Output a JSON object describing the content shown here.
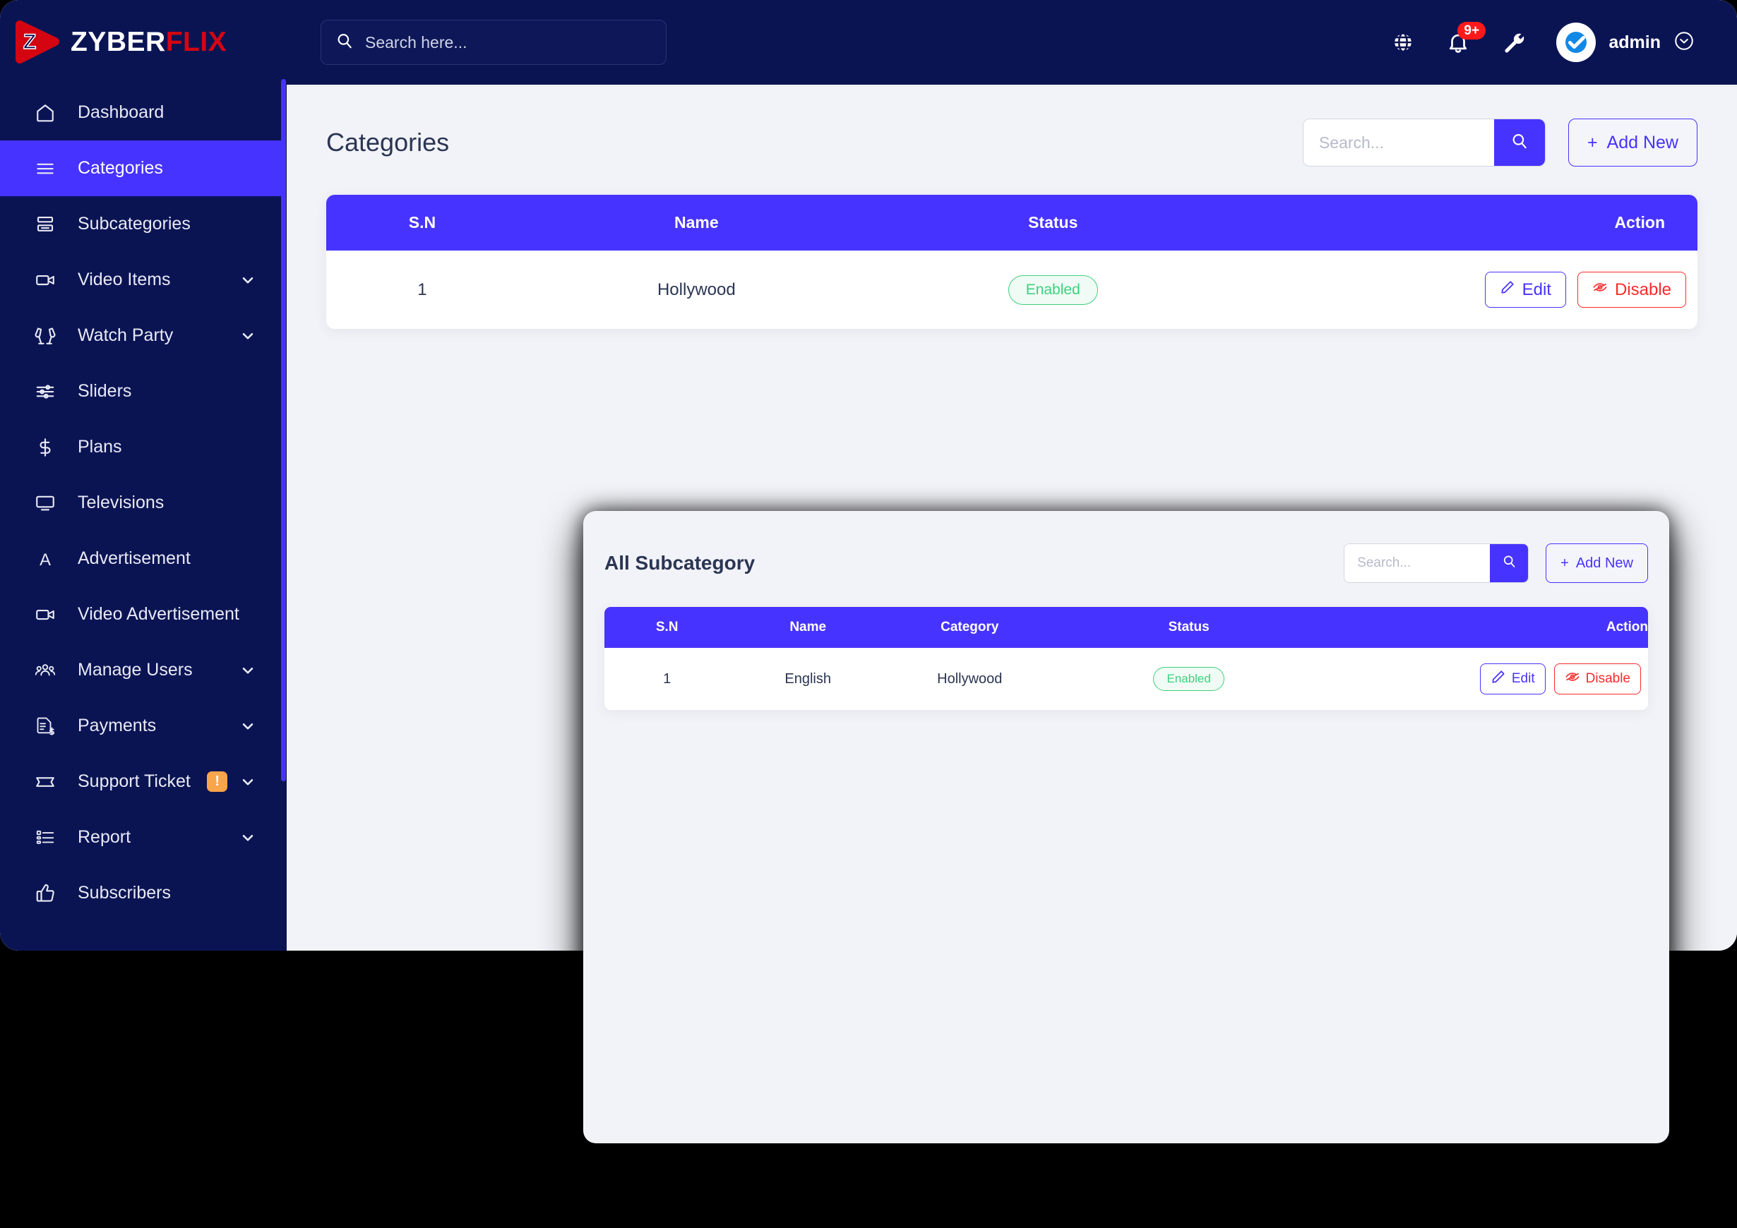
{
  "brand": {
    "name_primary": "ZYBER",
    "name_secondary": "FLIX",
    "logo_letter": "Z"
  },
  "topbar": {
    "search_placeholder": "Search here...",
    "search_value": "",
    "notification_badge": "9+",
    "user_name": "admin",
    "icons": [
      "globe-icon",
      "bell-icon",
      "wrench-icon",
      "chevron-down-circle-icon"
    ]
  },
  "sidebar": {
    "items": [
      {
        "label": "Dashboard",
        "icon": "home-icon",
        "active": false,
        "caret": false,
        "badge": null
      },
      {
        "label": "Categories",
        "icon": "list-icon",
        "active": true,
        "caret": false,
        "badge": null
      },
      {
        "label": "Subcategories",
        "icon": "layers-icon",
        "active": false,
        "caret": false,
        "badge": null
      },
      {
        "label": "Video Items",
        "icon": "video-camera-icon",
        "active": false,
        "caret": true,
        "badge": null
      },
      {
        "label": "Watch Party",
        "icon": "cheers-icon",
        "active": false,
        "caret": true,
        "badge": null
      },
      {
        "label": "Sliders",
        "icon": "sliders-icon",
        "active": false,
        "caret": false,
        "badge": null
      },
      {
        "label": "Plans",
        "icon": "dollar-icon",
        "active": false,
        "caret": false,
        "badge": null
      },
      {
        "label": "Televisions",
        "icon": "tv-icon",
        "active": false,
        "caret": false,
        "badge": null
      },
      {
        "label": "Advertisement",
        "icon": "letter-a-icon",
        "active": false,
        "caret": false,
        "badge": null
      },
      {
        "label": "Video Advertisement",
        "icon": "video-camera-icon",
        "active": false,
        "caret": false,
        "badge": null
      },
      {
        "label": "Manage Users",
        "icon": "users-icon",
        "active": false,
        "caret": true,
        "badge": null
      },
      {
        "label": "Payments",
        "icon": "invoice-icon",
        "active": false,
        "caret": true,
        "badge": null
      },
      {
        "label": "Support Ticket",
        "icon": "ticket-icon",
        "active": false,
        "caret": true,
        "badge": "!"
      },
      {
        "label": "Report",
        "icon": "report-list-icon",
        "active": false,
        "caret": true,
        "badge": null
      },
      {
        "label": "Subscribers",
        "icon": "thumbs-up-icon",
        "active": false,
        "caret": false,
        "badge": null
      }
    ]
  },
  "categories_page": {
    "title": "Categories",
    "search_placeholder": "Search...",
    "search_value": "",
    "add_new_label": "Add New",
    "columns": [
      "S.N",
      "Name",
      "Status",
      "Action"
    ],
    "rows": [
      {
        "sn": "1",
        "name": "Hollywood",
        "status": "Enabled",
        "edit_label": "Edit",
        "disable_label": "Disable"
      }
    ]
  },
  "subcategory_panel": {
    "title": "All Subcategory",
    "search_placeholder": "Search...",
    "search_value": "",
    "add_new_label": "Add New",
    "columns": [
      "S.N",
      "Name",
      "Category",
      "Status",
      "Action"
    ],
    "rows": [
      {
        "sn": "1",
        "name": "English",
        "category": "Hollywood",
        "status": "Enabled",
        "edit_label": "Edit",
        "disable_label": "Disable"
      }
    ]
  },
  "colors": {
    "sidebar_bg": "#0b1453",
    "accent": "#4733ff",
    "page_bg": "#f2f3f8",
    "danger": "#fa2a2a",
    "success": "#3ed07e",
    "badge_orange": "#f9a54a",
    "logo_red": "#d40511"
  }
}
